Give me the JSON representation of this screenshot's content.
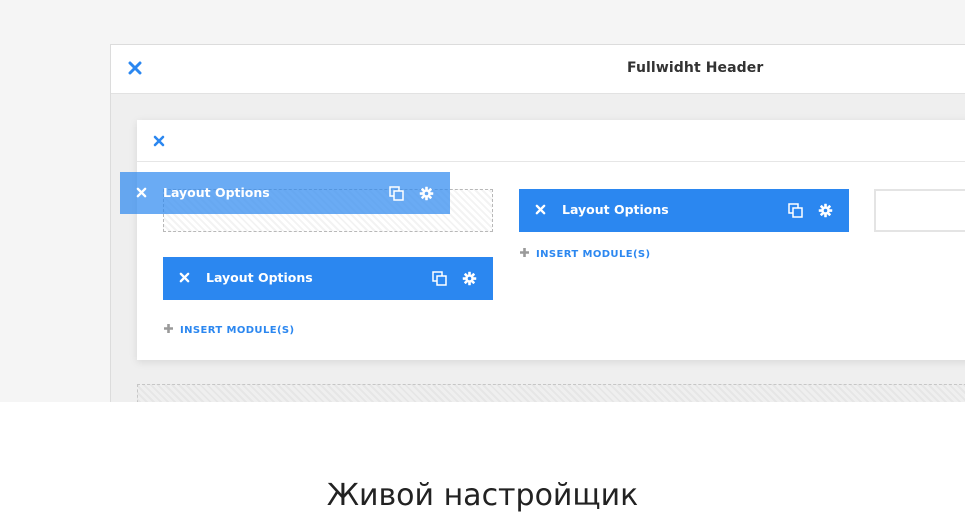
{
  "section": {
    "title": "Fullwidht Header",
    "close_icon": "close-icon"
  },
  "row": {
    "close_icon": "close-icon"
  },
  "modules": {
    "dragging": {
      "label": "Layout Options"
    },
    "left": {
      "label": "Layout Options"
    },
    "right": {
      "label": "Layout Options"
    }
  },
  "insert": {
    "left_label": "INSERT MODULE(S)",
    "right_label": "INSERT MODULE(S)"
  },
  "caption": {
    "text": "Живой настройщик"
  },
  "colors": {
    "accent": "#2b87f0",
    "text_dark": "#333333",
    "panel_bg": "#efefef"
  }
}
